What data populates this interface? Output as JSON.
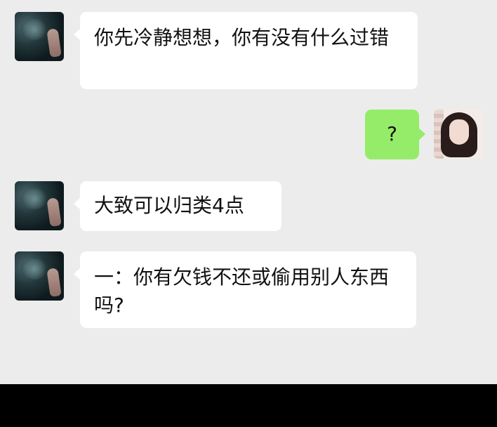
{
  "colors": {
    "background": "#ececec",
    "incoming_bubble": "#ffffff",
    "outgoing_bubble": "#95ec69",
    "bottom_bar": "#000000"
  },
  "messages": [
    {
      "side": "incoming",
      "avatar": "landscape-hand-avatar",
      "text": "你先冷静想想，你有没有什么过错"
    },
    {
      "side": "outgoing",
      "avatar": "woman-portrait-avatar",
      "text": "?"
    },
    {
      "side": "incoming",
      "avatar": "landscape-hand-avatar",
      "text": "大致可以归类4点"
    },
    {
      "side": "incoming",
      "avatar": "landscape-hand-avatar",
      "text": "一：你有欠钱不还或偷用别人东西吗?"
    }
  ]
}
